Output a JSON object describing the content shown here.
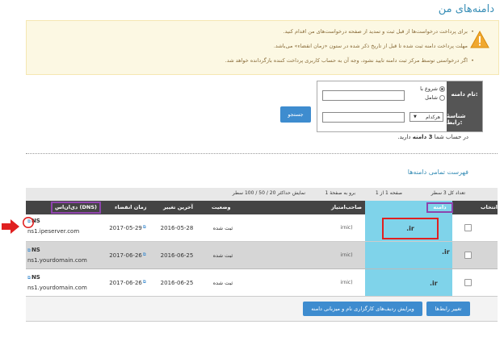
{
  "page_title": "دامنه‌های من",
  "notice": {
    "lines": [
      "برای پرداخت درخواست‌ها از قبل ثبت و تمدید از صفحه درخواست‌های من اقدام کنید.",
      "مهلت پرداخت دامنه ثبت شده تا قبل از تاریخ ذکر شده در ستون «زمان انقضاء» می‌باشد.",
      "اگر درخواستی توسط مرکز ثبت دامنه تایید نشود، وجه آن به حساب کاربری پرداخت کننده بازگردانده خواهد شد."
    ]
  },
  "search": {
    "domain_label": "نام دامنه:",
    "starts_with": "شروع با",
    "contains": "شامل",
    "contact_label": "شناسهٔ رابط:",
    "contact_select": "هرکدام",
    "button": "جستجو"
  },
  "summary_prefix": "در حساب شما ",
  "summary_count": "3 دامنه",
  "summary_suffix": " دارید.",
  "list_title": "فهرست تمامی دامنه‌ها",
  "pager": {
    "total": "تعداد کل 3 سطر",
    "page": "صفحه 1 از 1",
    "goto": "برو به صفحهٔ 1",
    "show": "نمایش حداکثر 20 / 50 / 100 سطر"
  },
  "columns": {
    "select": "انتخاب",
    "domain": "دامنه",
    "holder": "صاحب‌امتیاز",
    "status": "وضعیت",
    "last_change": "آخرین تغییر",
    "expire": "زمان انقضاء",
    "dns": "دی‌ان‌اس (DNS)"
  },
  "rows": [
    {
      "domain": ".ir",
      "holder": "irnic)",
      "status": "ثبت شده",
      "last_change": "2016-05-28",
      "expire": "2017-05-29",
      "dns_label": "NS",
      "dns_host": "ns1.ipeserver.com"
    },
    {
      "domain": ".ir",
      "holder": "irnic)",
      "status": "ثبت شده",
      "last_change": "2016-06-25",
      "expire": "2017-06-26",
      "dns_label": "NS",
      "dns_host": "ns1.yourdomain.com"
    },
    {
      "domain": ".ir",
      "holder": "irnic)",
      "status": "ثبت شده",
      "last_change": "2016-06-25",
      "expire": "2017-06-26",
      "dns_label": "NS",
      "dns_host": "ns1.yourdomain.com"
    }
  ],
  "buttons": {
    "change_contacts": "تغییر رابط‌ها",
    "edit_dns": "ویرایش ردیف‌های کارگزاری نام و میزبانی دامنه"
  },
  "colors": {
    "accent": "#3a8fb7",
    "button": "#3e8ccf",
    "highlight_box": "#8e44ad",
    "red_marker": "#e02020",
    "domain_cell": "#7fd3ea"
  }
}
